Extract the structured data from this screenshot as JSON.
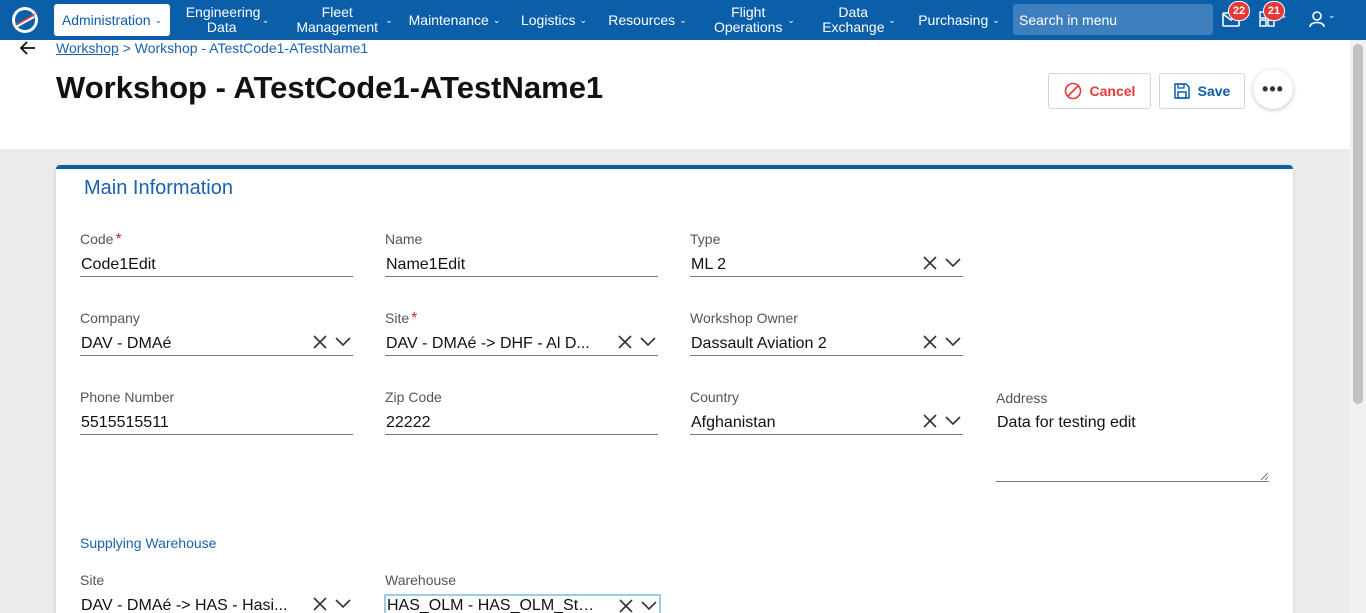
{
  "nav": {
    "items": [
      {
        "label": "Administration"
      },
      {
        "label": "Engineering Data"
      },
      {
        "label": "Fleet Management"
      },
      {
        "label": "Maintenance"
      },
      {
        "label": "Logistics"
      },
      {
        "label": "Resources"
      },
      {
        "label": "Flight Operations"
      },
      {
        "label": "Data Exchange"
      },
      {
        "label": "Purchasing"
      }
    ],
    "search_placeholder": "Search in menu",
    "mail_badge": "22",
    "tasks_badge": "21"
  },
  "breadcrumb": {
    "parent": "Workshop",
    "separator": ">",
    "current": "Workshop - ATestCode1-ATestName1"
  },
  "page_title": "Workshop - ATestCode1-ATestName1",
  "actions": {
    "cancel": "Cancel",
    "save": "Save",
    "more": "•••"
  },
  "section": {
    "title": "Main Information",
    "supplying_title": "Supplying Warehouse"
  },
  "fields": {
    "code": {
      "label": "Code",
      "value": "Code1Edit",
      "required": "*"
    },
    "name": {
      "label": "Name",
      "value": "Name1Edit"
    },
    "type": {
      "label": "Type",
      "value": "ML 2"
    },
    "company": {
      "label": "Company",
      "value": "DAV - DMAé"
    },
    "site": {
      "label": "Site",
      "value": "DAV - DMAé -> DHF - Al D...",
      "required": "*"
    },
    "workshop_owner": {
      "label": "Workshop Owner",
      "value": "Dassault Aviation 2"
    },
    "phone": {
      "label": "Phone Number",
      "value": "5515515511"
    },
    "zip": {
      "label": "Zip Code",
      "value": "22222"
    },
    "country": {
      "label": "Country",
      "value": "Afghanistan"
    },
    "address": {
      "label": "Address",
      "value": "Data for testing edit"
    },
    "sw_site": {
      "label": "Site",
      "value": "DAV - DMAé -> HAS - Hasi..."
    },
    "sw_warehouse": {
      "label": "Warehouse",
      "value": "HAS_OLM - HAS_OLM_Stor..."
    }
  },
  "colors": {
    "brand": "#0b5ea8",
    "cancel": "#e53935",
    "required": "#c62828"
  }
}
